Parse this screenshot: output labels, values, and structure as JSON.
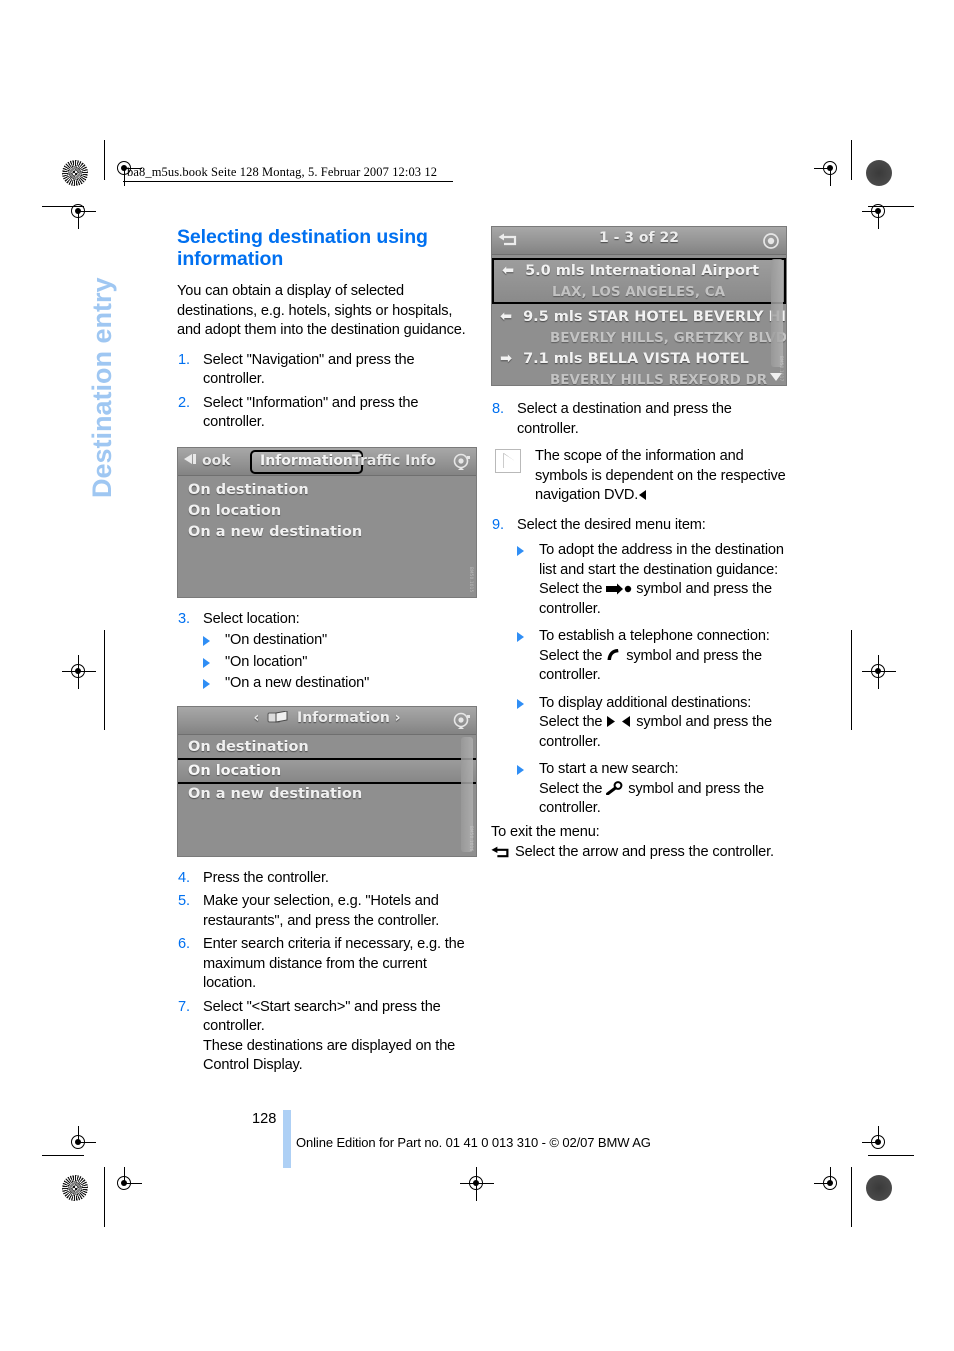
{
  "print_marks": {
    "running_header": "ba8_m5us.book  Seite 128  Montag, 5. Februar 2007  12:03 12"
  },
  "chapter": {
    "label": "Destination entry"
  },
  "left_column": {
    "title": "Selecting destination using information",
    "intro": "You can obtain a display of selected destinations, e.g. hotels, sights or hospitals, and adopt them into the destination guidance.",
    "steps": [
      {
        "num": "1.",
        "text": "Select \"Navigation\" and press the controller."
      },
      {
        "num": "2.",
        "text": "Select \"Information\" and press the controller."
      }
    ],
    "step3": {
      "num": "3.",
      "text": "Select location:",
      "options": [
        "\"On destination\"",
        "\"On location\"",
        "\"On a new destination\""
      ]
    },
    "steps_after": [
      {
        "num": "4.",
        "text": "Press the controller."
      },
      {
        "num": "5.",
        "text": "Make your selection, e.g. \"Hotels and restaurants\", and press the controller."
      },
      {
        "num": "6.",
        "text": "Enter search criteria if necessary, e.g. the maximum distance from the current location."
      },
      {
        "num": "7.",
        "text": "Select \"<Start search>\" and press the controller.\nThese destinations are displayed on the Control Display."
      }
    ]
  },
  "screenshot_info_tabs": {
    "tabs": [
      {
        "label": "ook",
        "selected": false
      },
      {
        "label": "Information",
        "selected": true
      },
      {
        "label": "Traffic Info",
        "selected": false
      }
    ],
    "items": [
      "On destination",
      "On location",
      "On a new destination"
    ],
    "credit": "BM50.1015"
  },
  "screenshot_info_selected": {
    "title": "Information",
    "left_chevron": "‹",
    "right_chevron": "›",
    "items": [
      {
        "label": "On destination",
        "selected": false
      },
      {
        "label": "On location",
        "selected": true
      },
      {
        "label": "On a new destination",
        "selected": false
      }
    ],
    "credit": "BM50.1016"
  },
  "screenshot_destination_list": {
    "back_icon": "back-arrow-icon",
    "title": "1 - 3 of 22",
    "menu_icon": "controller-icon",
    "rows": [
      {
        "direction": "left",
        "distance": "5.0  mls",
        "name": "International Airport",
        "address": "LAX, LOS ANGELES, CA",
        "selected": true
      },
      {
        "direction": "left",
        "distance": "9.5  mls",
        "name": "STAR HOTEL BEVERLY HILLS",
        "address": "BEVERLY HILLS, GRETZKY BLVD",
        "selected": false
      },
      {
        "direction": "right",
        "distance": "7.1  mls",
        "name": "BELLA VISTA HOTEL",
        "address": "BEVERLY HILLS REXFORD DR",
        "selected": false
      }
    ],
    "credit": "BM50.1017"
  },
  "right_column": {
    "step8": {
      "num": "8.",
      "text": "Select a destination and press the controller."
    },
    "note": "The scope of the information and symbols is dependent on the respective navigation DVD.",
    "step9": {
      "num": "9.",
      "text": "Select the desired menu item:"
    },
    "menu_items": [
      {
        "line1": "To adopt the address in the destination list and start the destination guidance:",
        "prefix": "Select the",
        "symbol": "arrow-dot-icon",
        "suffix": "symbol and press the controller."
      },
      {
        "line1": "To establish a telephone connection:",
        "prefix": "Select the",
        "symbol": "phone-icon",
        "suffix": "symbol and press the controller."
      },
      {
        "line1": "To display additional destinations:",
        "prefix": "Select the",
        "symbol": "prev-next-icon",
        "suffix": "symbol and press the controller."
      },
      {
        "line1": "To start a new search:",
        "prefix": "Select the",
        "symbol": "magnifier-icon",
        "suffix": "symbol and press the controller."
      }
    ],
    "exit_heading": "To exit the menu:",
    "exit_text": "Select the arrow and press the controller."
  },
  "footer": {
    "page_number": "128",
    "legal": "Online Edition for Part no. 01 41 0 013 310 - © 02/07 BMW AG",
    "bar_color": "#aed0f5"
  },
  "colors": {
    "heading_blue": "#0070f0",
    "chapter_blue": "#9fc7f2",
    "bullet_blue": "#2f8ef5",
    "screen_gray": "#8f8f8f"
  }
}
